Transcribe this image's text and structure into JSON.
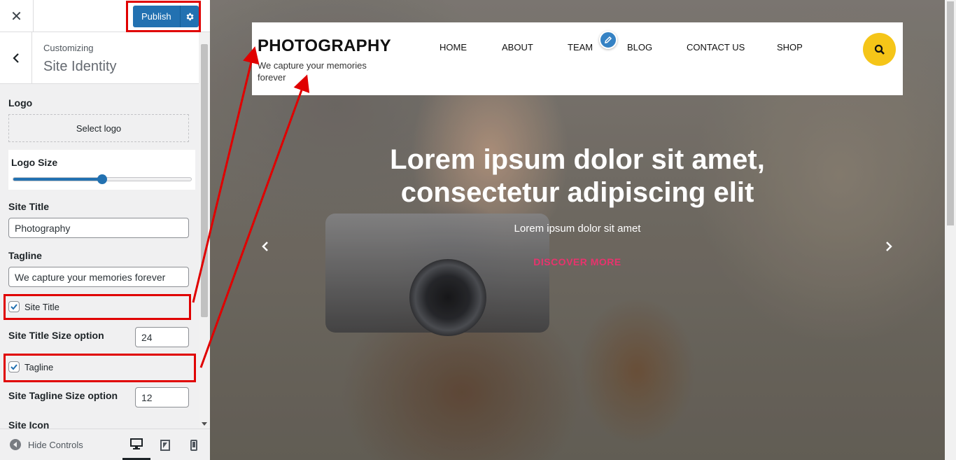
{
  "customizer": {
    "close_icon": "close-icon",
    "publish_label": "Publish",
    "customizing_label": "Customizing",
    "section_title": "Site Identity",
    "logo": {
      "label": "Logo",
      "button_label": "Select logo"
    },
    "logo_size": {
      "label": "Logo Size",
      "value_fraction": 0.5
    },
    "site_title": {
      "label": "Site Title",
      "value": "Photography"
    },
    "tagline": {
      "label": "Tagline",
      "value": "We capture your memories forever"
    },
    "show_site_title": {
      "label": "Site Title",
      "checked": true
    },
    "site_title_size": {
      "label": "Site Title Size option",
      "value": "24"
    },
    "show_tagline": {
      "label": "Tagline",
      "checked": true
    },
    "tagline_size": {
      "label": "Site Tagline Size option",
      "value": "12"
    },
    "site_icon": {
      "label": "Site Icon"
    },
    "footer": {
      "hide_controls_label": "Hide Controls"
    }
  },
  "preview": {
    "site_title": "PHOTOGRAPHY",
    "site_tagline": "We capture your memories forever",
    "nav": [
      {
        "label": "HOME"
      },
      {
        "label": "ABOUT"
      },
      {
        "label": "TEAM"
      },
      {
        "label": "BLOG"
      },
      {
        "label": "CONTACT US"
      },
      {
        "label": "SHOP"
      }
    ],
    "hero": {
      "heading_line1": "Lorem ipsum dolor sit amet,",
      "heading_line2": "consectetur adipiscing elit",
      "subtext": "Lorem ipsum dolor sit amet",
      "cta": "DISCOVER MORE"
    }
  },
  "colors": {
    "publish": "#2271b1",
    "search_button": "#f5c518",
    "cta": "#e8336d",
    "annotation": "#e00000"
  }
}
